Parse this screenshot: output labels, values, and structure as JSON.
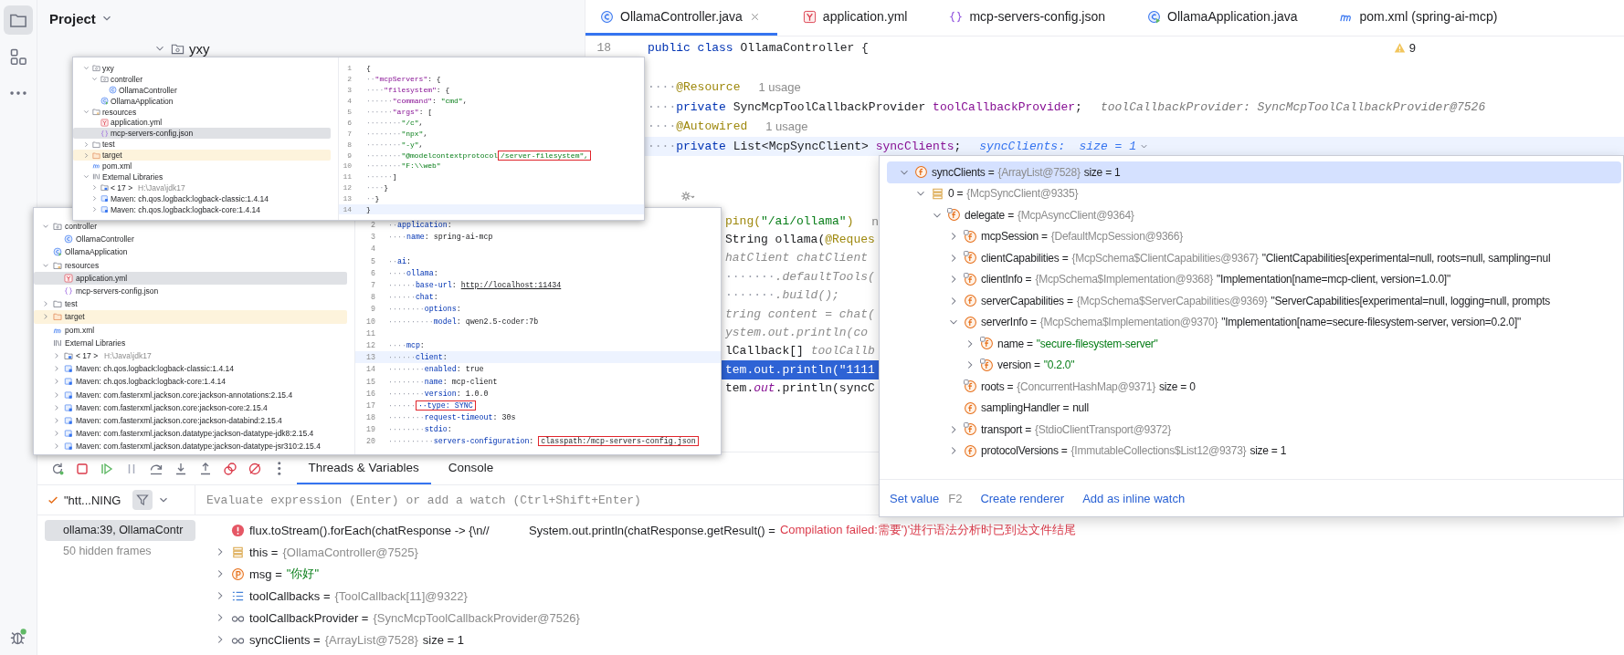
{
  "sidebar": {
    "items": [
      {
        "kind": "folder",
        "selected": true
      },
      {
        "kind": "structure",
        "selected": false
      },
      {
        "kind": "more",
        "selected": false
      }
    ],
    "bottom_items": [
      {
        "kind": "debug",
        "selected": false
      }
    ]
  },
  "project_panel": {
    "title": "Project",
    "tree": [
      {
        "label": "yxy",
        "kind": "package",
        "expanded": true,
        "selected": false
      }
    ]
  },
  "editor": {
    "tabs": [
      {
        "label": "OllamaController.java",
        "kind": "class",
        "selected": true
      },
      {
        "label": "application.yml",
        "kind": "yaml",
        "selected": false
      },
      {
        "label": "mcp-servers-config.json",
        "kind": "json",
        "selected": false
      },
      {
        "label": "OllamaApplication.java",
        "kind": "app",
        "selected": false
      },
      {
        "label": "pom.xml (spring-ai-mcp)",
        "kind": "maven",
        "selected": false
      }
    ],
    "warnings": "9",
    "lines": [
      {
        "number": "18",
        "segments": [
          {
            "text": "public class ",
            "kind": "keyword"
          },
          {
            "text": "OllamaController {",
            "kind": "plain"
          }
        ]
      },
      {
        "segments": [
          {
            "text": "····",
            "kind": "ws"
          },
          {
            "text": "@Resource",
            "kind": "annotation"
          },
          {
            "text": "1 usage",
            "kind": "hint"
          }
        ]
      },
      {
        "segments": [
          {
            "text": "····",
            "kind": "ws"
          },
          {
            "text": "private ",
            "kind": "keyword"
          },
          {
            "text": "SyncMcpToolCallbackProvider ",
            "kind": "plain"
          },
          {
            "text": "toolCallbackProvider",
            "kind": "field"
          },
          {
            "text": ";",
            "kind": "plain"
          },
          {
            "text": "toolCallbackProvider: SyncMcpToolCallbackProvider@7526",
            "kind": "inline_value"
          }
        ]
      },
      {
        "segments": [
          {
            "text": "····",
            "kind": "ws"
          },
          {
            "text": "@Autowired",
            "kind": "annotation"
          },
          {
            "text": "1 usage",
            "kind": "hint"
          }
        ]
      },
      {
        "current_line": true,
        "segments": [
          {
            "text": "····",
            "kind": "ws"
          },
          {
            "text": "private ",
            "kind": "keyword"
          },
          {
            "text": "List<McpSyncClient> ",
            "kind": "plain"
          },
          {
            "text": "syncClients",
            "kind": "field"
          },
          {
            "text": ";",
            "kind": "plain"
          },
          {
            "text": "syncClients:  size = 1",
            "kind": "inline_watch"
          }
        ]
      }
    ],
    "partial_lines": [
      {
        "segments": [
          {
            "text": "ping(",
            "kind": "annotation"
          },
          {
            "text": "\"/ai/ollama\"",
            "kind": "string"
          },
          {
            "text": ")",
            "kind": "annotation"
          },
          {
            "text": "n",
            "kind": "hint"
          }
        ]
      },
      {
        "segments": [
          {
            "text": "String ollama(",
            "kind": "plain"
          },
          {
            "text": "@Reques",
            "kind": "annotation"
          }
        ]
      },
      {
        "segments": [
          {
            "text": "hatClient chatClient",
            "kind": "dim"
          }
        ]
      },
      {
        "segments": [
          {
            "text": "·······",
            "kind": "ws"
          },
          {
            "text": ".defaultTools(",
            "kind": "dim"
          }
        ]
      },
      {
        "segments": [
          {
            "text": "·······",
            "kind": "ws"
          },
          {
            "text": ".build();",
            "kind": "dim"
          }
        ]
      },
      {
        "segments": [
          {
            "text": "tring content = chat(",
            "kind": "dim"
          }
        ]
      },
      {
        "segments": [
          {
            "text": "ystem.out.println(co",
            "kind": "dim"
          }
        ]
      },
      {
        "segments": [
          {
            "text": "lCallback[] ",
            "kind": "plain"
          },
          {
            "text": "toolCallb",
            "kind": "dim"
          }
        ]
      },
      {
        "execution_point": true,
        "segments": [
          {
            "text": "tem.out.println(\"1111",
            "kind": "plain"
          }
        ]
      },
      {
        "segments": [
          {
            "text": "tem.",
            "kind": "plain"
          },
          {
            "text": "out",
            "kind": "static"
          },
          {
            "text": ".println(syncC",
            "kind": "plain"
          }
        ]
      }
    ]
  },
  "insets": [
    {
      "tree": [
        {
          "label": "yxy",
          "kind": "package",
          "expanded": true,
          "selected": false,
          "children": [
            {
              "label": "controller",
              "kind": "package",
              "expanded": true,
              "selected": false,
              "children": [
                {
                  "label": "OllamaController",
                  "kind": "class",
                  "selected": false
                }
              ]
            },
            {
              "label": "OllamaApplication",
              "kind": "app",
              "selected": false
            }
          ]
        },
        {
          "label": "resources",
          "kind": "resources",
          "expanded": true,
          "selected": false,
          "children": [
            {
              "label": "application.yml",
              "kind": "yaml",
              "selected": false
            },
            {
              "label": "mcp-servers-config.json",
              "kind": "json",
              "selected": true
            }
          ]
        },
        {
          "label": "test",
          "kind": "folder",
          "expanded": false,
          "selected": false
        },
        {
          "label": "target",
          "kind": "excluded_folder",
          "expanded": false,
          "selected": false
        },
        {
          "label": "pom.xml",
          "kind": "maven",
          "selected": false
        },
        {
          "label": "External Libraries",
          "kind": "library",
          "expanded": true,
          "selected": false,
          "children": [
            {
              "label": "< 17 >",
              "detail": "H:\\Java\\jdk17",
              "kind": "sdk",
              "expanded": false,
              "selected": false
            },
            {
              "label": "Maven: ch.qos.logback:logback-classic:1.4.14",
              "kind": "jar",
              "expanded": false,
              "selected": false
            },
            {
              "label": "Maven: ch.qos.logback:logback-core:1.4.14",
              "kind": "jar",
              "expanded": false,
              "selected": false
            }
          ]
        }
      ],
      "code": [
        {
          "number": "1",
          "segments": [
            {
              "text": "{",
              "kind": "plain"
            }
          ]
        },
        {
          "number": "2",
          "segments": [
            {
              "text": "··",
              "kind": "ws"
            },
            {
              "text": "\"mcpServers\"",
              "kind": "key"
            },
            {
              "text": ": {",
              "kind": "plain"
            }
          ]
        },
        {
          "number": "3",
          "segments": [
            {
              "text": "····",
              "kind": "ws"
            },
            {
              "text": "\"filesystem\"",
              "kind": "key"
            },
            {
              "text": ": {",
              "kind": "plain"
            }
          ]
        },
        {
          "number": "4",
          "segments": [
            {
              "text": "······",
              "kind": "ws"
            },
            {
              "text": "\"command\"",
              "kind": "key"
            },
            {
              "text": ": ",
              "kind": "plain"
            },
            {
              "text": "\"cmd\"",
              "kind": "string"
            },
            {
              "text": ",",
              "kind": "plain"
            }
          ]
        },
        {
          "number": "5",
          "segments": [
            {
              "text": "······",
              "kind": "ws"
            },
            {
              "text": "\"args\"",
              "kind": "key"
            },
            {
              "text": ": [",
              "kind": "plain"
            }
          ]
        },
        {
          "number": "6",
          "segments": [
            {
              "text": "········",
              "kind": "ws"
            },
            {
              "text": "\"/c\"",
              "kind": "string"
            },
            {
              "text": ",",
              "kind": "plain"
            }
          ]
        },
        {
          "number": "7",
          "segments": [
            {
              "text": "········",
              "kind": "ws"
            },
            {
              "text": "\"npx\"",
              "kind": "string"
            },
            {
              "text": ",",
              "kind": "plain"
            }
          ]
        },
        {
          "number": "8",
          "segments": [
            {
              "text": "········",
              "kind": "ws"
            },
            {
              "text": "\"-y\"",
              "kind": "string"
            },
            {
              "text": ",",
              "kind": "plain"
            }
          ]
        },
        {
          "number": "9",
          "segments": [
            {
              "text": "········",
              "kind": "ws"
            },
            {
              "text": "\"@modelcontextprotocol",
              "kind": "string"
            },
            {
              "text": "/server-filesystem\",",
              "kind": "string",
              "boxed": true
            }
          ]
        },
        {
          "number": "10",
          "segments": [
            {
              "text": "········",
              "kind": "ws"
            },
            {
              "text": "\"F:\\\\web\"",
              "kind": "string"
            }
          ]
        },
        {
          "number": "11",
          "segments": [
            {
              "text": "······",
              "kind": "ws"
            },
            {
              "text": "]",
              "kind": "plain"
            }
          ]
        },
        {
          "number": "12",
          "segments": [
            {
              "text": "····",
              "kind": "ws"
            },
            {
              "text": "}",
              "kind": "plain"
            }
          ]
        },
        {
          "number": "13",
          "segments": [
            {
              "text": "··",
              "kind": "ws"
            },
            {
              "text": "}",
              "kind": "plain"
            }
          ]
        },
        {
          "number": "14",
          "current_line": true,
          "segments": [
            {
              "text": "}",
              "kind": "plain"
            }
          ]
        }
      ]
    },
    {
      "tree": [
        {
          "label": "controller",
          "kind": "package",
          "expanded": true,
          "selected": false,
          "children": [
            {
              "label": "OllamaController",
              "kind": "class",
              "selected": false
            }
          ]
        },
        {
          "label": "OllamaApplication",
          "kind": "app",
          "selected": false
        },
        {
          "label": "resources",
          "kind": "resources",
          "expanded": true,
          "selected": false,
          "children": [
            {
              "label": "application.yml",
              "kind": "yaml",
              "selected": true
            },
            {
              "label": "mcp-servers-config.json",
              "kind": "json",
              "selected": false
            }
          ]
        },
        {
          "label": "test",
          "kind": "folder",
          "expanded": false,
          "selected": false
        },
        {
          "label": "target",
          "kind": "excluded_folder",
          "expanded": false,
          "selected": false
        },
        {
          "label": "pom.xml",
          "kind": "maven",
          "selected": false
        },
        {
          "label": "External Libraries",
          "kind": "library",
          "selected": false,
          "children": [
            {
              "label": "< 17 >",
              "detail": "H:\\Java\\jdk17",
              "kind": "sdk",
              "expanded": false,
              "selected": false
            },
            {
              "label": "Maven: ch.qos.logback:logback-classic:1.4.14",
              "kind": "jar",
              "expanded": false,
              "selected": false
            },
            {
              "label": "Maven: ch.qos.logback:logback-core:1.4.14",
              "kind": "jar",
              "expanded": false,
              "selected": false
            },
            {
              "label": "Maven: com.fasterxml.jackson.core:jackson-annotations:2.15.4",
              "kind": "jar",
              "expanded": false,
              "selected": false
            },
            {
              "label": "Maven: com.fasterxml.jackson.core:jackson-core:2.15.4",
              "kind": "jar",
              "expanded": false,
              "selected": false
            },
            {
              "label": "Maven: com.fasterxml.jackson.core:jackson-databind:2.15.4",
              "kind": "jar",
              "expanded": false,
              "selected": false
            },
            {
              "label": "Maven: com.fasterxml.jackson.datatype:jackson-datatype-jdk8:2.15.4",
              "kind": "jar",
              "expanded": false,
              "selected": false
            },
            {
              "label": "Maven: com.fasterxml.jackson.datatype:jackson-datatype-jsr310:2.15.4",
              "kind": "jar",
              "expanded": false,
              "selected": false
            }
          ]
        }
      ],
      "code": [
        {
          "number": "2",
          "segments": [
            {
              "text": "··",
              "kind": "ws"
            },
            {
              "text": "application",
              "kind": "ykey"
            },
            {
              "text": ":",
              "kind": "plain"
            }
          ]
        },
        {
          "number": "3",
          "segments": [
            {
              "text": "····",
              "kind": "ws"
            },
            {
              "text": "name",
              "kind": "ykey"
            },
            {
              "text": ": spring-ai-mcp",
              "kind": "plain"
            }
          ]
        },
        {
          "number": "4"
        },
        {
          "number": "5",
          "segments": [
            {
              "text": "··",
              "kind": "ws"
            },
            {
              "text": "ai",
              "kind": "ykey"
            },
            {
              "text": ":",
              "kind": "plain"
            }
          ]
        },
        {
          "number": "6",
          "segments": [
            {
              "text": "····",
              "kind": "ws"
            },
            {
              "text": "ollama",
              "kind": "ykey"
            },
            {
              "text": ":",
              "kind": "plain"
            }
          ]
        },
        {
          "number": "7",
          "segments": [
            {
              "text": "······",
              "kind": "ws"
            },
            {
              "text": "base-url",
              "kind": "ykey"
            },
            {
              "text": ": ",
              "kind": "plain"
            },
            {
              "text": "http://localhost:11434",
              "kind": "url"
            }
          ]
        },
        {
          "number": "8",
          "segments": [
            {
              "text": "······",
              "kind": "ws"
            },
            {
              "text": "chat",
              "kind": "ykey"
            },
            {
              "text": ":",
              "kind": "plain"
            }
          ]
        },
        {
          "number": "9",
          "segments": [
            {
              "text": "········",
              "kind": "ws"
            },
            {
              "text": "options",
              "kind": "ykey"
            },
            {
              "text": ":",
              "kind": "plain"
            }
          ]
        },
        {
          "number": "10",
          "segments": [
            {
              "text": "··········",
              "kind": "ws"
            },
            {
              "text": "model",
              "kind": "ykey"
            },
            {
              "text": ": qwen2.5-coder:7b",
              "kind": "plain"
            }
          ]
        },
        {
          "number": "11"
        },
        {
          "number": "12",
          "segments": [
            {
              "text": "····",
              "kind": "ws"
            },
            {
              "text": "mcp",
              "kind": "ykey"
            },
            {
              "text": ":",
              "kind": "plain"
            }
          ]
        },
        {
          "number": "13",
          "current_line": true,
          "segments": [
            {
              "text": "······",
              "kind": "ws"
            },
            {
              "text": "client",
              "kind": "ykey"
            },
            {
              "text": ":",
              "kind": "plain"
            }
          ]
        },
        {
          "number": "14",
          "segments": [
            {
              "text": "········",
              "kind": "ws"
            },
            {
              "text": "enabled",
              "kind": "ykey"
            },
            {
              "text": ": true",
              "kind": "plain"
            }
          ]
        },
        {
          "number": "15",
          "segments": [
            {
              "text": "········",
              "kind": "ws"
            },
            {
              "text": "name",
              "kind": "ykey"
            },
            {
              "text": ": mcp-client",
              "kind": "plain"
            }
          ]
        },
        {
          "number": "16",
          "segments": [
            {
              "text": "········",
              "kind": "ws"
            },
            {
              "text": "version",
              "kind": "ykey"
            },
            {
              "text": ": 1.0.0",
              "kind": "plain"
            }
          ]
        },
        {
          "number": "17",
          "segments": [
            {
              "text": "······",
              "kind": "ws"
            },
            {
              "text": "··type: SYNC",
              "kind": "ykey",
              "boxed": true
            }
          ]
        },
        {
          "number": "18",
          "segments": [
            {
              "text": "········",
              "kind": "ws"
            },
            {
              "text": "request-timeout",
              "kind": "ykey"
            },
            {
              "text": ": 30s",
              "kind": "plain"
            }
          ]
        },
        {
          "number": "19",
          "segments": [
            {
              "text": "········",
              "kind": "ws"
            },
            {
              "text": "stdio",
              "kind": "ykey"
            },
            {
              "text": ":",
              "kind": "plain"
            }
          ]
        },
        {
          "number": "20",
          "segments": [
            {
              "text": "··········",
              "kind": "ws"
            },
            {
              "text": "servers-configuration",
              "kind": "ykey"
            },
            {
              "text": ": ",
              "kind": "plain"
            },
            {
              "text": "classpath:/mcp-servers-config.json",
              "kind": "plain",
              "boxed": true
            }
          ]
        }
      ]
    }
  ],
  "popup": {
    "tree": [
      {
        "name": "syncClients =",
        "type": "{ArrayList@7528}",
        "extra": "size = 1",
        "kind": "field",
        "expanded": true,
        "selected": true,
        "children": [
          {
            "name": "0 =",
            "type": "{McpSyncClient@9335}",
            "kind": "element",
            "expanded": true,
            "selected": false,
            "children": [
              {
                "name": "delegate =",
                "type": "{McpAsyncClient@9364}",
                "kind": "field_final",
                "expanded": true,
                "selected": false,
                "children": [
                  {
                    "name": "mcpSession =",
                    "type": "{DefaultMcpSession@9366}",
                    "kind": "field_final",
                    "expanded": false,
                    "selected": false
                  },
                  {
                    "name": "clientCapabilities =",
                    "type": "{McpSchema$ClientCapabilities@9367}",
                    "extra": "\"ClientCapabilities[experimental=null, roots=null, sampling=nul",
                    "kind": "field_final",
                    "expanded": false,
                    "selected": false
                  },
                  {
                    "name": "clientInfo =",
                    "type": "{McpSchema$Implementation@9368}",
                    "extra": "\"Implementation[name=mcp-client, version=1.0.0]\"",
                    "kind": "field_final",
                    "expanded": false,
                    "selected": false
                  },
                  {
                    "name": "serverCapabilities =",
                    "type": "{McpSchema$ServerCapabilities@9369}",
                    "extra": "\"ServerCapabilities[experimental=null, logging=null, prompts",
                    "kind": "field",
                    "expanded": false,
                    "selected": false
                  },
                  {
                    "name": "serverInfo =",
                    "type": "{McpSchema$Implementation@9370}",
                    "extra": "\"Implementation[name=secure-filesystem-server, version=0.2.0]\"",
                    "kind": "field",
                    "expanded": true,
                    "selected": false,
                    "children": [
                      {
                        "name": "name =",
                        "string": "\"secure-filesystem-server\"",
                        "kind": "field_final",
                        "expanded": false,
                        "selected": false
                      },
                      {
                        "name": "version =",
                        "string": "\"0.2.0\"",
                        "kind": "field_final",
                        "expanded": false,
                        "selected": false
                      }
                    ]
                  },
                  {
                    "name": "roots =",
                    "type": "{ConcurrentHashMap@9371}",
                    "extra": "size = 0",
                    "kind": "field_final",
                    "selected": false
                  },
                  {
                    "name": "samplingHandler =",
                    "extra": "null",
                    "kind": "field",
                    "selected": false
                  },
                  {
                    "name": "transport =",
                    "type": "{StdioClientTransport@9372}",
                    "kind": "field_final",
                    "expanded": false,
                    "selected": false
                  },
                  {
                    "name": "protocolVersions =",
                    "type": "{ImmutableCollections$List12@9373}",
                    "extra": "size = 1",
                    "kind": "field",
                    "expanded": false,
                    "selected": false
                  }
                ]
              }
            ]
          }
        ]
      }
    ],
    "actions": [
      {
        "label": "Set value",
        "shortcut": "F2"
      },
      {
        "label": "Create renderer"
      },
      {
        "label": "Add as inline watch"
      }
    ]
  },
  "debug": {
    "toolbar": [
      {
        "kind": "rerun"
      },
      {
        "kind": "stop"
      },
      {
        "kind": "resume"
      },
      {
        "kind": "pause"
      },
      {
        "kind": "step_over"
      },
      {
        "kind": "step_into"
      },
      {
        "kind": "step_out"
      },
      {
        "kind": "breakpoints"
      },
      {
        "kind": "mute"
      },
      {
        "kind": "more"
      }
    ],
    "tabs": [
      {
        "label": "Threads & Variables",
        "selected": true
      },
      {
        "label": "Console",
        "selected": false
      }
    ],
    "thread": "\"htt...NING",
    "expression": {
      "placeholder": "Evaluate expression (Enter) or add a watch (Ctrl+Shift+Enter)"
    },
    "frames": [
      {
        "label": "ollama:39, OllamaContr",
        "kind": "frame",
        "selected": true
      },
      {
        "label": "50 hidden frames",
        "kind": "hidden",
        "selected": false
      }
    ],
    "variables": [
      {
        "kind": "error",
        "expression": "flux.toStream().forEach(chatResponse -> {\\n//            System.out.println(chatResponse.getResult() =",
        "error": "Compilation failed:需要')'进行语法分析时已到达文件结尾"
      },
      {
        "kind": "object",
        "name": "this =",
        "type": "{OllamaController@7525}",
        "expanded": false
      },
      {
        "kind": "param",
        "name": "msg =",
        "string": "\"你好\"",
        "expanded": false
      },
      {
        "kind": "array",
        "name": "toolCallbacks =",
        "type": "{ToolCallback[11]@9322}",
        "expanded": false
      },
      {
        "kind": "watch",
        "name": "toolCallbackProvider =",
        "type": "{SyncMcpToolCallbackProvider@7526}",
        "expanded": false
      },
      {
        "kind": "watch",
        "name": "syncClients =",
        "type": "{ArrayList@7528}",
        "extra": "size = 1",
        "expanded": false
      }
    ]
  }
}
